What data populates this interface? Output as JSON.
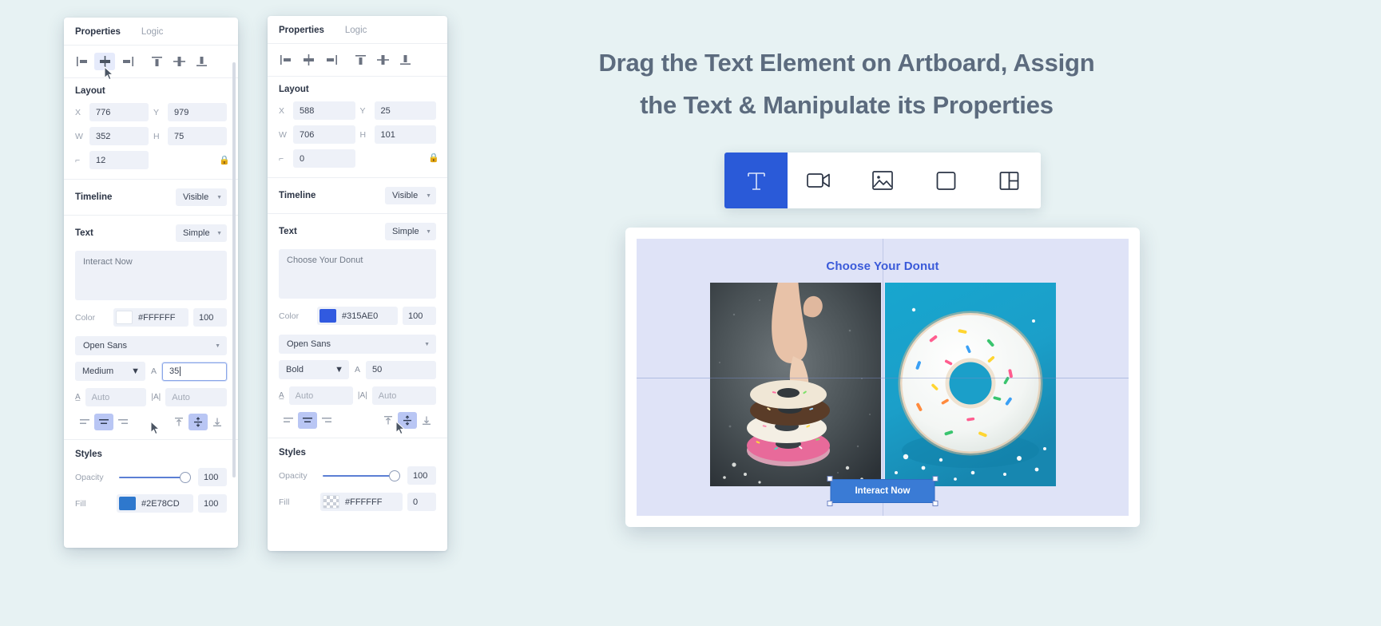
{
  "panel_1": {
    "tabs": [
      {
        "label": "Properties",
        "active": true
      },
      {
        "label": "Logic",
        "active": false
      }
    ],
    "align_icons": [
      "align-left-icon",
      "align-center-horizontal-icon",
      "align-right-icon",
      "align-top-icon",
      "align-center-vertical-icon",
      "align-bottom-icon"
    ],
    "layout": {
      "title": "Layout",
      "x_label": "X",
      "x_value": "776",
      "y_label": "Y",
      "y_value": "979",
      "w_label": "W",
      "w_value": "352",
      "h_label": "H",
      "h_value": "75",
      "radius_label": "corner-radius",
      "radius_value": "12",
      "lock_icon": "lock-icon"
    },
    "timeline": {
      "label": "Timeline",
      "value": "Visible"
    },
    "text": {
      "label": "Text",
      "mode": "Simple",
      "content": "Interact Now",
      "color_label": "Color",
      "color_hex": "#FFFFFF",
      "color_swatch": "#FFFFFF",
      "color_opacity": "100",
      "font_family": "Open Sans",
      "font_weight": "Medium",
      "size_label": "A",
      "size_value": "35",
      "line_height_label": "line-height",
      "line_height_value": "Auto",
      "letter_spacing_label": "letter-spacing",
      "letter_spacing_value": "Auto",
      "h_align": "center",
      "v_align": "middle"
    },
    "styles": {
      "title": "Styles",
      "opacity_label": "Opacity",
      "opacity_value": "100",
      "fill_label": "Fill",
      "fill_hex": "#2E78CD",
      "fill_swatch": "#2E78CD",
      "fill_opacity": "100"
    }
  },
  "panel_2": {
    "tabs": [
      {
        "label": "Properties",
        "active": true
      },
      {
        "label": "Logic",
        "active": false
      }
    ],
    "align_icons": [
      "align-left-icon",
      "align-center-horizontal-icon",
      "align-right-icon",
      "align-top-icon",
      "align-center-vertical-icon",
      "align-bottom-icon"
    ],
    "layout": {
      "title": "Layout",
      "x_label": "X",
      "x_value": "588",
      "y_label": "Y",
      "y_value": "25",
      "w_label": "W",
      "w_value": "706",
      "h_label": "H",
      "h_value": "101",
      "radius_label": "corner-radius",
      "radius_value": "0",
      "lock_icon": "lock-icon"
    },
    "timeline": {
      "label": "Timeline",
      "value": "Visible"
    },
    "text": {
      "label": "Text",
      "mode": "Simple",
      "content": "Choose Your Donut",
      "color_label": "Color",
      "color_hex": "#315AE0",
      "color_swatch": "#315AE0",
      "color_opacity": "100",
      "font_family": "Open Sans",
      "font_weight": "Bold",
      "size_label": "A",
      "size_value": "50",
      "line_height_label": "line-height",
      "line_height_value": "Auto",
      "letter_spacing_label": "letter-spacing",
      "letter_spacing_value": "Auto",
      "h_align": "center",
      "v_align": "middle"
    },
    "styles": {
      "title": "Styles",
      "opacity_label": "Opacity",
      "opacity_value": "100",
      "fill_label": "Fill",
      "fill_hex": "#FFFFFF",
      "fill_swatch": "transparent-checker",
      "fill_opacity": "0"
    }
  },
  "headline": {
    "line_1": "Drag the Text Element on Artboard, Assign",
    "line_2": "the Text & Manipulate its Properties",
    "color": "#5C6B7E"
  },
  "toolbar": {
    "active_color": "#2A5AD8",
    "items": [
      {
        "icon": "text-tool-icon",
        "active": true
      },
      {
        "icon": "video-tool-icon",
        "active": false
      },
      {
        "icon": "image-tool-icon",
        "active": false
      },
      {
        "icon": "rectangle-tool-icon",
        "active": false
      },
      {
        "icon": "layout-tool-icon",
        "active": false
      }
    ]
  },
  "artboard": {
    "title": "Choose Your Donut",
    "title_color": "#3A5AD9",
    "background": "#DFE3F7",
    "left_photo": "hand-picking-stacked-donuts-photo",
    "right_photo": "sprinkled-donut-on-blue-photo",
    "cta_label": "Interact Now",
    "cta_color": "#3A7BD5"
  }
}
